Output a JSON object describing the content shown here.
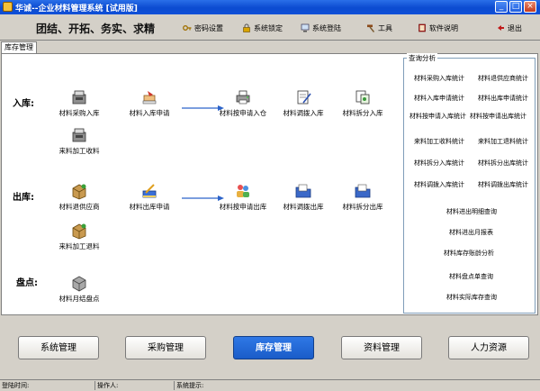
{
  "window": {
    "title": "华诚--企业材料管理系统 [试用版]"
  },
  "toolbar": {
    "slogan": "团结、开拓、务实、求精",
    "buttons": [
      {
        "label": "密码设置",
        "icon": "key-icon"
      },
      {
        "label": "系统锁定",
        "icon": "lock-icon"
      },
      {
        "label": "系统登陆",
        "icon": "login-icon"
      },
      {
        "label": "工具",
        "icon": "hammer-icon"
      },
      {
        "label": "软件说明",
        "icon": "book-icon"
      },
      {
        "label": "退出",
        "icon": "exit-icon"
      }
    ]
  },
  "tab": {
    "label": "库存管理"
  },
  "sections": {
    "inbound": "入库:",
    "outbound": "出库:",
    "inventory": "盘点:"
  },
  "inbound": {
    "purchase_in": "材料采购入库",
    "in_request": "材料入库申请",
    "in_by_request": "材料按申请入仓",
    "transfer_in": "材料调拨入库",
    "split_in": "材料拆分入库",
    "processing_receipt": "来料加工收料"
  },
  "outbound": {
    "return_supplier": "材料退供应商",
    "out_request": "材料出库申请",
    "out_by_request": "材料按申请出库",
    "transfer_out": "材料调拨出库",
    "split_out": "材料拆分出库",
    "processing_return": "来料加工退料"
  },
  "inventory": {
    "monthly_count": "材料月结盘点"
  },
  "query": {
    "title": "查询分析",
    "items": [
      "材料采购入库统计",
      "材料退供应商统计",
      "材料入库申请统计",
      "材料出库申请统计",
      "材料按申请入库统计",
      "材料按申请出库统计",
      "来料加工收料统计",
      "来料加工退料统计",
      "材料拆分入库统计",
      "材料拆分出库统计",
      "材料调拨入库统计",
      "材料调拨出库统计",
      "材料进出明细查询",
      "材料进出月报表",
      "材料库存账龄分析",
      "材料盘点单查询",
      "材料实际库存查询"
    ]
  },
  "nav": [
    "系统管理",
    "采购管理",
    "库存管理",
    "资料管理",
    "人力资源"
  ],
  "status": {
    "login_time": "登陆时间:",
    "operator": "操作人:",
    "hint": "系统提示:"
  },
  "colors": {
    "titlebar": "#0b4bd0",
    "active_nav": "#1a5cc8",
    "arrow": "#2c63c9"
  }
}
